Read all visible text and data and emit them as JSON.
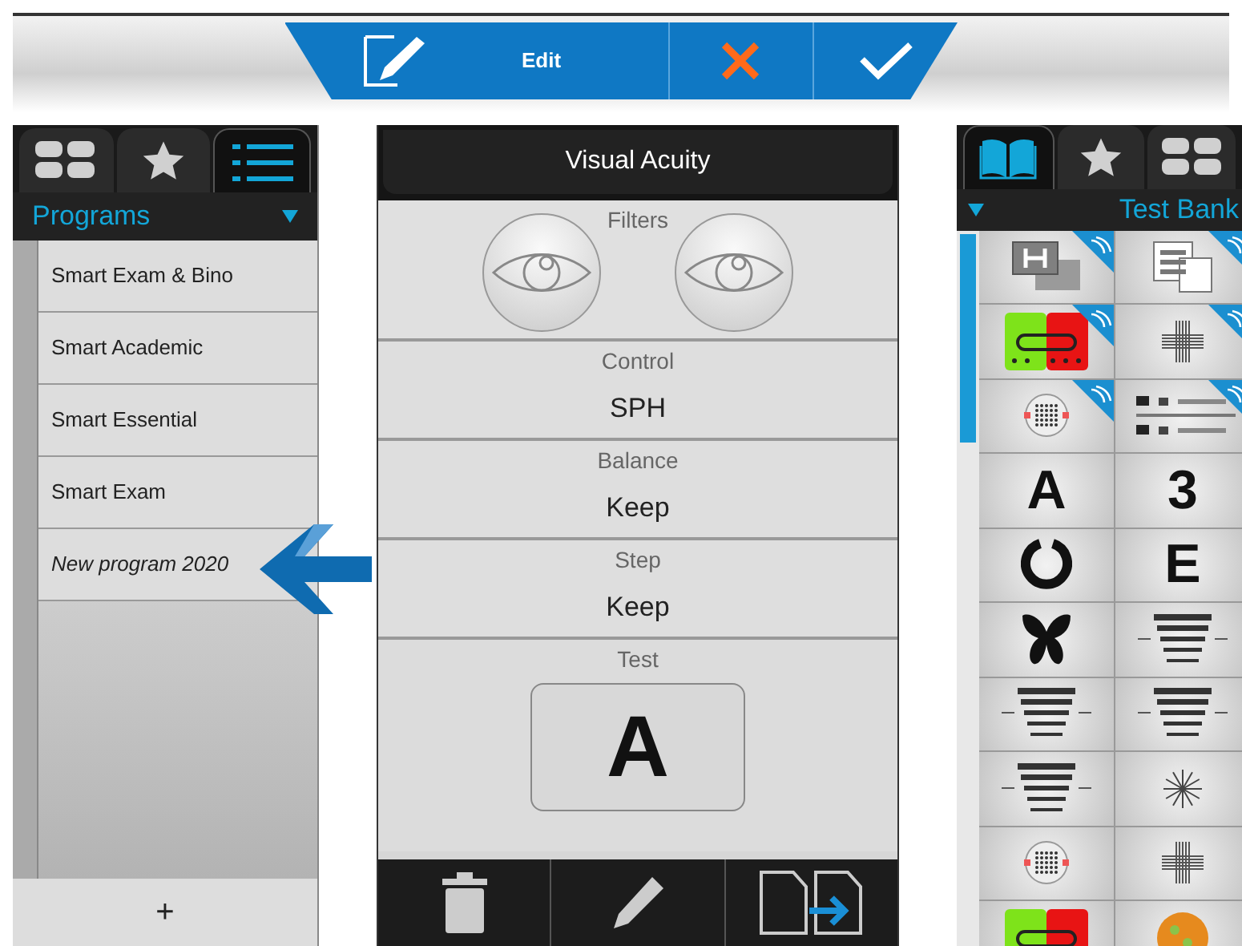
{
  "toolbar": {
    "buttons": [
      {
        "kind": "edit",
        "label": "Edit"
      },
      {
        "kind": "cancel"
      },
      {
        "kind": "confirm"
      }
    ]
  },
  "programs_panel": {
    "tabs": [
      {
        "kind": "grid",
        "selected": false
      },
      {
        "kind": "star",
        "selected": false
      },
      {
        "kind": "list",
        "selected": true
      }
    ],
    "dropdown": "Programs",
    "items": [
      {
        "label": "Smart Exam & Bino",
        "unsaved": false
      },
      {
        "label": "Smart Academic",
        "unsaved": false
      },
      {
        "label": "Smart Essential",
        "unsaved": false
      },
      {
        "label": "Smart Exam",
        "unsaved": false
      },
      {
        "label": "New program 2020",
        "unsaved": true
      }
    ],
    "add_button": "+"
  },
  "test_panel": {
    "title": "Visual Acuity",
    "sections": [
      {
        "kind": "filters",
        "label": "Filters"
      },
      {
        "kind": "value",
        "label": "Control",
        "value": "SPH"
      },
      {
        "kind": "value",
        "label": "Balance",
        "value": "Keep"
      },
      {
        "kind": "value",
        "label": "Step",
        "value": "Keep"
      },
      {
        "kind": "test",
        "label": "Test",
        "value": "A"
      }
    ],
    "footer": [
      {
        "kind": "delete"
      },
      {
        "kind": "edit"
      },
      {
        "kind": "copy"
      }
    ]
  },
  "test_bank": {
    "tabs": [
      {
        "kind": "book",
        "selected": true
      },
      {
        "kind": "star",
        "selected": false
      },
      {
        "kind": "grid",
        "selected": false
      }
    ],
    "dropdown": "Test Bank",
    "tiles": [
      {
        "kind": "h-pair",
        "badge": true
      },
      {
        "kind": "letter-card",
        "badge": true
      },
      {
        "kind": "red-green",
        "badge": true
      },
      {
        "kind": "cross",
        "badge": true
      },
      {
        "kind": "dot-disc",
        "badge": true
      },
      {
        "kind": "line-pair",
        "badge": true
      },
      {
        "kind": "letter",
        "text": "A",
        "badge": false
      },
      {
        "kind": "letter",
        "text": "3",
        "badge": false
      },
      {
        "kind": "landolt",
        "badge": false
      },
      {
        "kind": "letter",
        "text": "E",
        "badge": false
      },
      {
        "kind": "butterfly",
        "badge": false
      },
      {
        "kind": "chart",
        "badge": false
      },
      {
        "kind": "chart",
        "badge": false
      },
      {
        "kind": "chart",
        "badge": false
      },
      {
        "kind": "chart",
        "badge": false
      },
      {
        "kind": "dial",
        "badge": false
      },
      {
        "kind": "dot-disc",
        "badge": false
      },
      {
        "kind": "cross",
        "badge": false
      },
      {
        "kind": "red-green",
        "badge": false
      },
      {
        "kind": "color-plate",
        "badge": false
      }
    ]
  }
}
